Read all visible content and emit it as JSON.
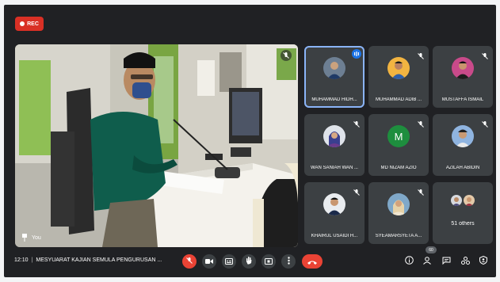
{
  "recording": {
    "label": "REC"
  },
  "main_video": {
    "name": "You"
  },
  "participants": [
    {
      "name": "MUHAMMAD HIDH...",
      "speaking": true
    },
    {
      "name": "MUHAMMAD ADIB ..."
    },
    {
      "name": "MUSTAFFA ISMAIL"
    },
    {
      "name": "WAN SANIAH WAN ..."
    },
    {
      "name": "MD NIZAM AZIO",
      "avatar_letter": "M"
    },
    {
      "name": "AZILAH ABIDIN"
    },
    {
      "name": "KHAIRUL USAIDI H..."
    },
    {
      "name": "SYEAMARSYETA A..."
    }
  ],
  "others": {
    "label": "51 others"
  },
  "bottom_bar": {
    "time": "12:10",
    "meeting_title": "MESYUARAT KAJIAN SEMULA PENGURUSAN ...",
    "people_badge": "60"
  },
  "colors": {
    "accent": "#8ab4f8",
    "danger": "#ea4335",
    "panel": "#3c4043",
    "background": "#202124"
  },
  "icons": [
    "mic-off-icon",
    "camera-icon",
    "captions-icon",
    "raise-hand-icon",
    "present-icon",
    "more-icon",
    "hang-up-icon",
    "info-icon",
    "people-icon",
    "chat-icon",
    "activities-icon",
    "host-controls-icon"
  ]
}
